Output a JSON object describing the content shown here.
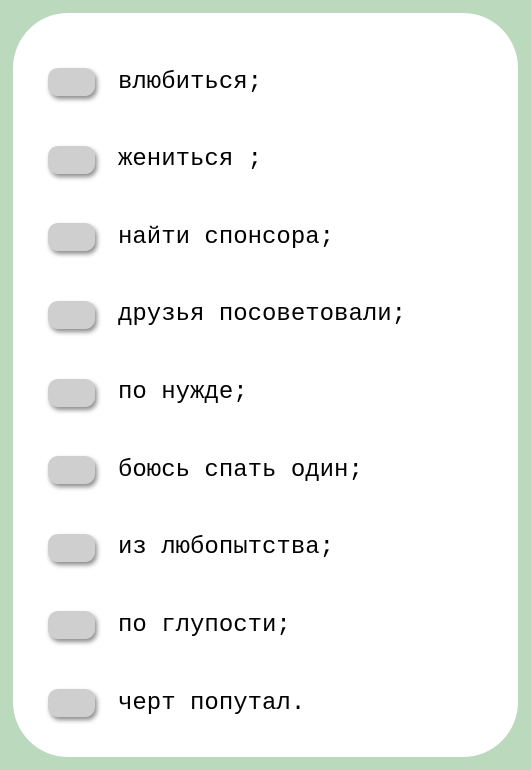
{
  "items": [
    {
      "label": "влюбиться;"
    },
    {
      "label": "жениться ;"
    },
    {
      "label": "найти спонсора;"
    },
    {
      "label": "друзья посоветовали;"
    },
    {
      "label": "по нужде;"
    },
    {
      "label": "боюсь спать один;"
    },
    {
      "label": "из любопытства;"
    },
    {
      "label": "по глупости;"
    },
    {
      "label": "черт попутал."
    }
  ]
}
